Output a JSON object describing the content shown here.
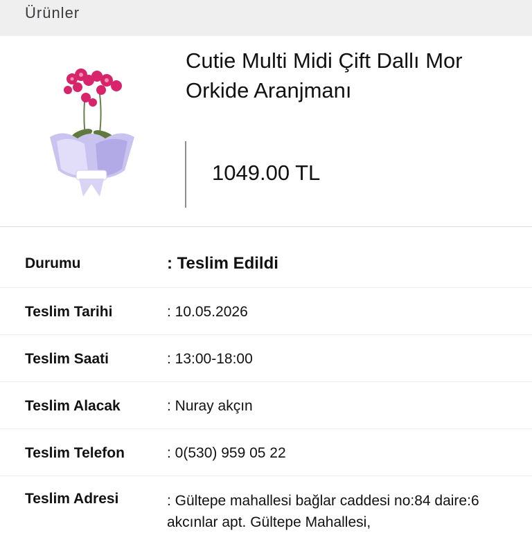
{
  "section": {
    "title": "Ürünler"
  },
  "product": {
    "name": "Cutie Multi Midi Çift Dallı Mor Orkide Aranjmanı",
    "price": "1049.00 TL",
    "image_icon": "orchid-arrangement-image"
  },
  "details": {
    "status": {
      "label": "Durumu",
      "value": ": Teslim Edildi"
    },
    "delivery_date": {
      "label": "Teslim Tarihi",
      "value": ": 10.05.2026"
    },
    "delivery_time": {
      "label": "Teslim Saati",
      "value": ": 13:00-18:00"
    },
    "recipient": {
      "label": "Teslim Alacak",
      "value": ": Nuray akçın"
    },
    "phone": {
      "label": "Teslim Telefon",
      "value": ": 0(530) 959 05 22"
    },
    "address": {
      "label": "Teslim Adresi",
      "value": ": Gültepe mahallesi bağlar caddesi no:84 daire:6 akcınlar apt. Gültepe Mahallesi,"
    }
  }
}
